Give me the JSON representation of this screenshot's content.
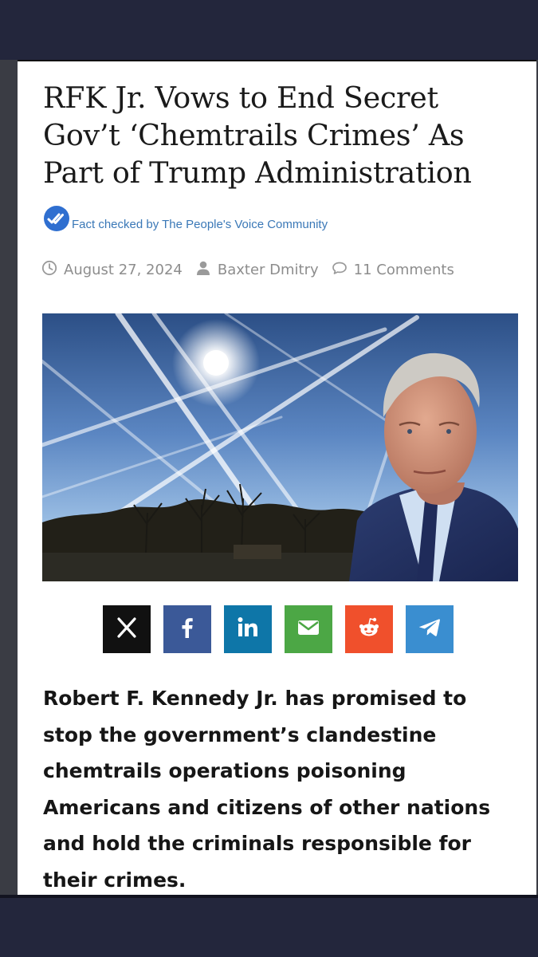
{
  "article": {
    "title": "RFK Jr. Vows to End Secret Gov’t ‘Chemtrails Crimes’ As Part of Trump Administration",
    "fact_check": "Fact checked by The People's Voice Community",
    "meta": {
      "date": "August 27, 2024",
      "author": "Baxter Dmitry",
      "comments": "11 Comments"
    },
    "hero_image": {
      "alt": "Robert F. Kennedy Jr. in front of a sky crossed with contrails"
    },
    "share_buttons": [
      {
        "network": "x",
        "icon": "x-icon",
        "color": "#111111"
      },
      {
        "network": "facebook",
        "icon": "facebook-icon",
        "color": "#3b5998"
      },
      {
        "network": "linkedin",
        "icon": "linkedin-icon",
        "color": "#0e76a8"
      },
      {
        "network": "email",
        "icon": "envelope-icon",
        "color": "#4ca745"
      },
      {
        "network": "reddit",
        "icon": "reddit-icon",
        "color": "#f0502c"
      },
      {
        "network": "telegram",
        "icon": "telegram-icon",
        "color": "#3a8ed0"
      }
    ],
    "lead": "Robert F. Kennedy Jr. has promised to stop the government’s clandestine chemtrails operations poisoning Americans and citizens of other nations and hold the criminals responsible for their crimes."
  },
  "colors": {
    "page_background": "#23263c",
    "card_background": "#ffffff",
    "fact_check_blue": "#3a78b7",
    "meta_gray": "#8d8d8d"
  }
}
